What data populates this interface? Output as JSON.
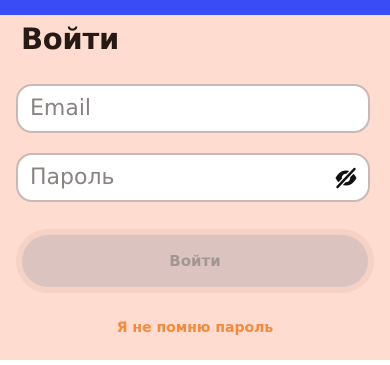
{
  "colors": {
    "top_bar": "#3a4cf5",
    "panel_bg": "#ffdccf",
    "title": "#261b14",
    "field_border": "#c7b9b3",
    "placeholder": "#8a8382",
    "button_bg_disabled": "#dbc4c0",
    "button_text_disabled": "#a39692",
    "link": "#f48a3c"
  },
  "form": {
    "title": "Войти",
    "email_placeholder": "Email",
    "password_placeholder": "Пароль",
    "password_toggle_icon": "eye-off-icon",
    "submit_label": "Войти",
    "submit_state": "disabled",
    "forgot_link": "Я не помню пароль"
  }
}
